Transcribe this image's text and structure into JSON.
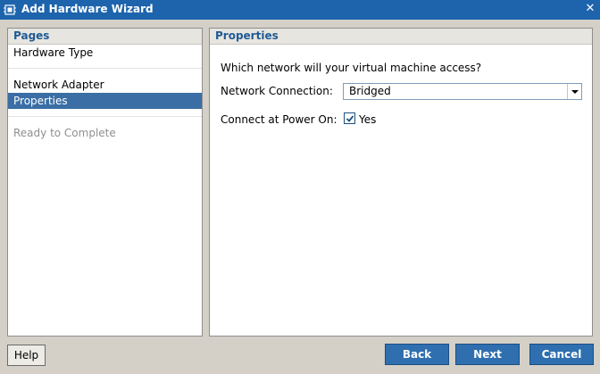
{
  "window": {
    "title": "Add Hardware Wizard",
    "close_glyph": "✕",
    "title_icon": "hardware-chip-icon"
  },
  "pages_panel": {
    "header": "Pages",
    "items": [
      {
        "label": "Hardware Type",
        "state": "normal"
      },
      {
        "label": "Network Adapter",
        "state": "normal"
      },
      {
        "label": "Properties",
        "state": "selected"
      },
      {
        "label": "Ready to Complete",
        "state": "disabled"
      }
    ]
  },
  "properties_panel": {
    "header": "Properties",
    "question": "Which network will your virtual machine access?",
    "network_connection_label": "Network Connection:",
    "network_connection_value": "Bridged",
    "connect_at_power_on_label": "Connect at Power On:",
    "connect_at_power_on_checked": true,
    "connect_at_power_on_option": "Yes"
  },
  "buttons": {
    "help": "Help",
    "back": "Back",
    "next": "Next",
    "cancel": "Cancel"
  },
  "colors": {
    "titlebar": "#1d64ad",
    "selected_item": "#3a6ea5",
    "panel_header_text": "#1f5a96",
    "primary_button": "#2f6faf"
  }
}
